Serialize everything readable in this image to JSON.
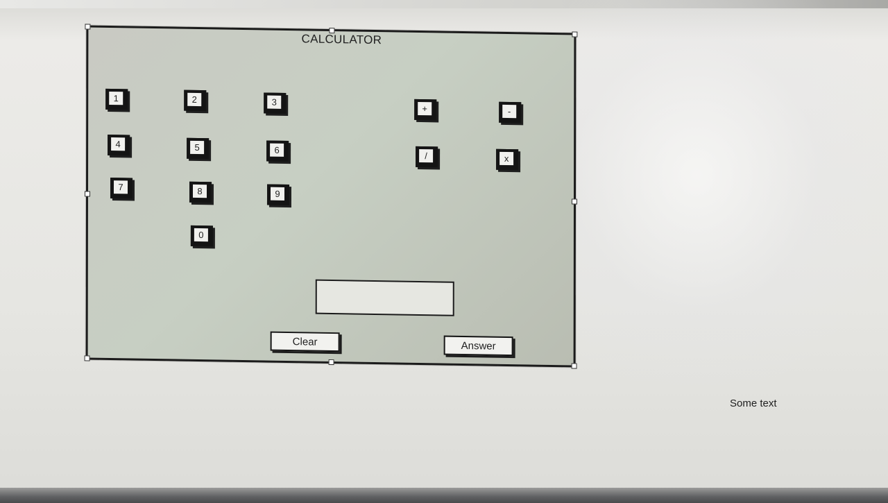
{
  "calculator": {
    "title": "CALCULATOR",
    "digit_keys": [
      "1",
      "2",
      "3",
      "4",
      "5",
      "6",
      "7",
      "8",
      "9",
      "0"
    ],
    "operator_keys": [
      "+",
      "-",
      "/",
      "x"
    ],
    "clear_label": "Clear",
    "answer_label": "Answer",
    "display_value": ""
  },
  "footer_text": "Some text"
}
